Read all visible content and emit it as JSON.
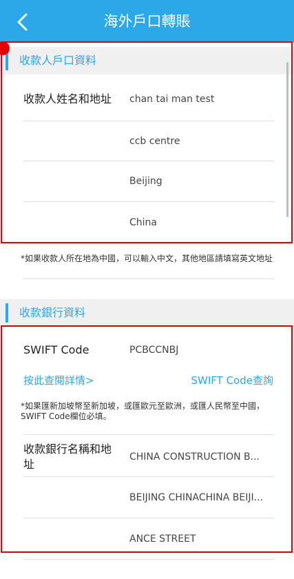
{
  "header": {
    "title": "海外戶口轉賬"
  },
  "payee_section": {
    "title": "收款人戶口資料",
    "name_address_label": "收款人姓名和地址",
    "address_lines": [
      "chan tai man test",
      "ccb centre",
      "Beijing",
      "China"
    ],
    "note": "*如果收款人所在地為中國，可以輸入中文，其他地區請填寫英文地址"
  },
  "bank_section": {
    "title": "收款銀行資料",
    "swift_label": "SWIFT Code",
    "swift_value": "PCBCCNBJ",
    "details_link": "按此查閱詳情>",
    "swift_lookup_link": "SWIFT  Code查詢",
    "note": "*如果匯新加坡幣至新加坡，或匯歐元至歐洲，或匯人民幣至中國，SWIFT Code欄位必填。",
    "bank_name_label": "收款銀行名稱和地址",
    "bank_lines": [
      "CHINA CONSTRUCTION B...",
      "BEIJING CHINACHINA BEIJI...",
      "ANCE STREET"
    ]
  },
  "colors": {
    "brand": "#2aa8e8",
    "highlight": "#e00000"
  },
  "icons": {
    "back": "back-chevron-icon"
  }
}
